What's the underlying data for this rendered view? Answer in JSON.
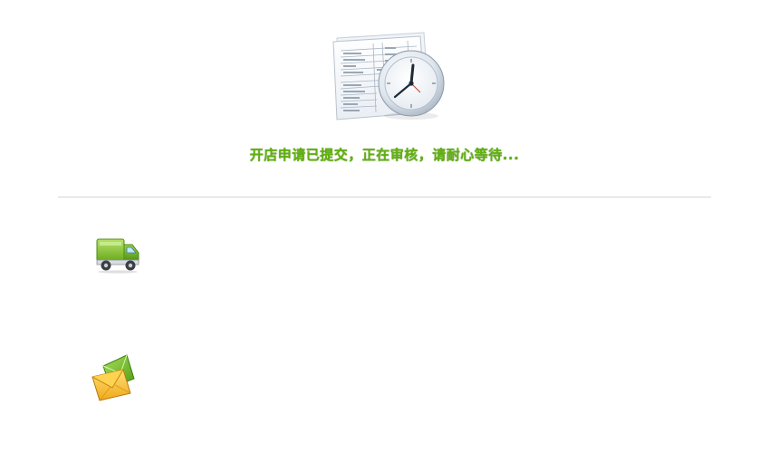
{
  "status": {
    "message": "开店申请已提交，正在审核，请耐心等待...",
    "illustration_icon": "document-clock-icon"
  },
  "icons": {
    "delivery": "truck-icon",
    "mail": "envelope-icon"
  },
  "colors": {
    "message": "#62b012",
    "divider": "#d6d6d6",
    "background": "#ffffff"
  }
}
